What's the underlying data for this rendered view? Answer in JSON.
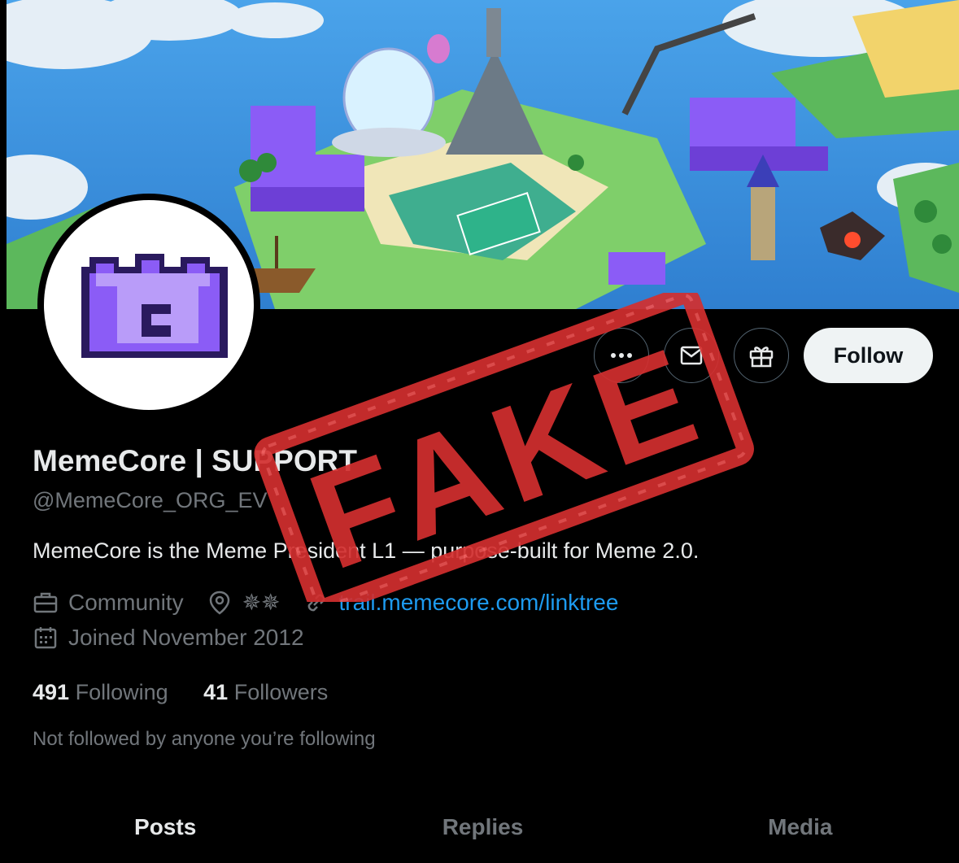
{
  "profile": {
    "display_name": "MemeCore | SUPPORT",
    "handle": "@MemeCore_ORG_EV",
    "bio": "MemeCore is the Meme President L1 — purpose-built for Meme 2.0.",
    "category": "Community",
    "location": "✵✵",
    "website": "trail.memecore.com/linktree",
    "joined": "Joined November 2012",
    "following_count": "491",
    "following_label": "Following",
    "followers_count": "41",
    "followers_label": "Followers",
    "not_followed_text": "Not followed by anyone you’re following"
  },
  "actions": {
    "more_icon": "more-icon",
    "message_icon": "message-icon",
    "gift_icon": "gift-icon",
    "follow_label": "Follow"
  },
  "tabs": [
    {
      "label": "Posts",
      "active": true
    },
    {
      "label": "Replies",
      "active": false
    },
    {
      "label": "Media",
      "active": false
    }
  ],
  "stamp": {
    "text": "FAKE",
    "color": "#d32f2f"
  },
  "colors": {
    "background": "#000000",
    "link": "#1d9bf0",
    "muted": "#71767b",
    "avatar_purple": "#8b5cf6"
  }
}
